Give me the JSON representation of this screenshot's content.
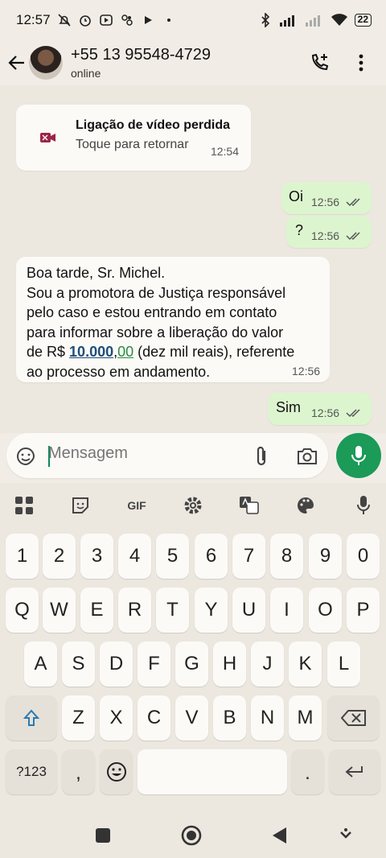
{
  "status_bar": {
    "time": "12:57",
    "battery": "22"
  },
  "header": {
    "contact_name": "+55 13 95548-4729",
    "contact_status": "online"
  },
  "messages": {
    "missed_call": {
      "title": "Ligação de vídeo perdida",
      "subtitle": "Toque para retornar",
      "time": "12:54"
    },
    "out1": {
      "text": "Oi",
      "time": "12:56"
    },
    "out2": {
      "text": "?",
      "time": "12:56"
    },
    "incoming": {
      "line1": "Boa tarde, Sr. Michel.",
      "line2": "Sou a promotora de Justiça responsável",
      "line3": "pelo caso e estou entrando em contato",
      "line4": "para informar sobre a liberação do valor",
      "line5_prefix": "de R$ ",
      "line5_number": "10.000",
      "line5_comma": ",",
      "line5_decimal": "00",
      "line5_suffix": " (dez mil reais), referente",
      "line6": "ao processo em andamento.",
      "time": "12:56"
    },
    "out3": {
      "text": "Sim",
      "time": "12:56"
    }
  },
  "input": {
    "placeholder": "Mensagem"
  },
  "keyboard": {
    "toolbar": {
      "gif_label": "GIF"
    },
    "row_numbers": [
      "1",
      "2",
      "3",
      "4",
      "5",
      "6",
      "7",
      "8",
      "9",
      "0"
    ],
    "row1": [
      "Q",
      "W",
      "E",
      "R",
      "T",
      "Y",
      "U",
      "I",
      "O",
      "P"
    ],
    "row2": [
      "A",
      "S",
      "D",
      "F",
      "G",
      "H",
      "J",
      "K",
      "L"
    ],
    "row3": [
      "Z",
      "X",
      "C",
      "V",
      "B",
      "N",
      "M"
    ],
    "symbols_key": "?123",
    "comma_key": ",",
    "period_key": "."
  },
  "colors": {
    "accent_green": "#1b9a58",
    "outgoing_bubble": "#dcf5cf",
    "missed_call_icon": "#9b2449",
    "link_blue": "#1f4e79"
  },
  "icons": {
    "back": "arrow-left-icon",
    "add_call": "phone-plus-icon",
    "menu": "more-vertical-icon",
    "emoji": "sticker-smile-icon",
    "attach": "paperclip-icon",
    "camera": "camera-icon",
    "mic": "mic-icon"
  }
}
